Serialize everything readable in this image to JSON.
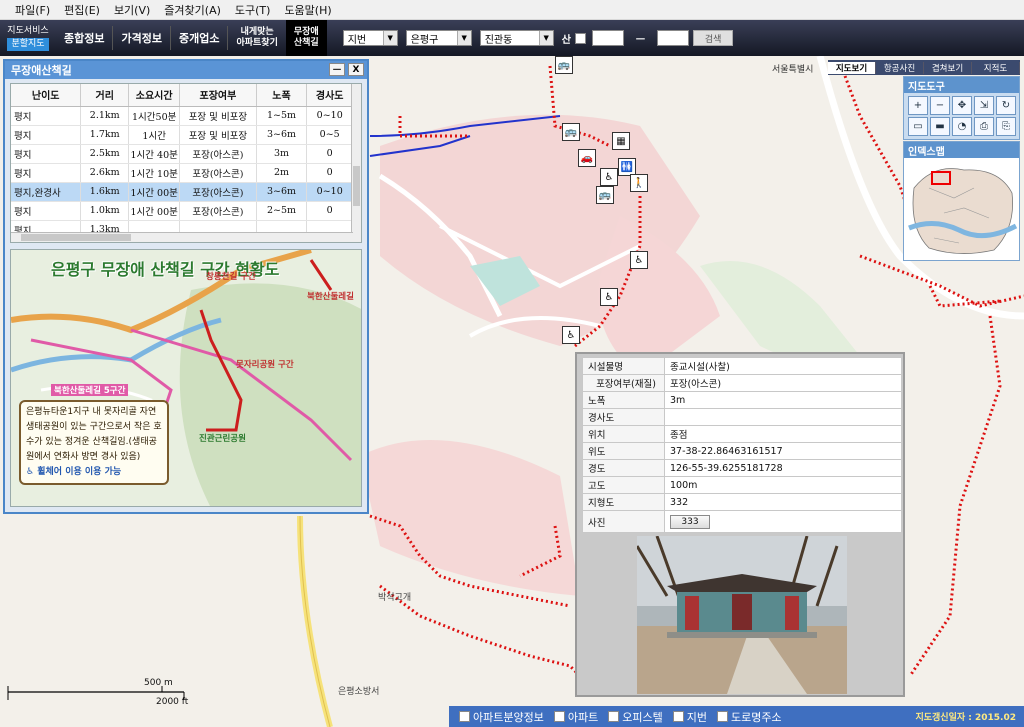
{
  "menu": [
    "파일(F)",
    "편집(E)",
    "보기(V)",
    "즐겨찾기(A)",
    "도구(T)",
    "도움말(H)"
  ],
  "topbar": {
    "service_label": "지도서비스",
    "service_sub": "분할지도",
    "nav": [
      "종합정보",
      "가격정보",
      "중개업소"
    ],
    "nav_small": [
      "내게맞는",
      "아파트찾기"
    ],
    "active": [
      "무장애",
      "산책길"
    ],
    "selects": [
      "지번",
      "은평구",
      "진관동"
    ],
    "mountain_label": "산",
    "dash": "ㅡ",
    "search_label": "검색"
  },
  "panel": {
    "title": "무장애산책길",
    "min": "ㅡ",
    "close": "X",
    "columns": [
      "난이도",
      "거리",
      "소요시간",
      "포장여부",
      "노폭",
      "경사도"
    ],
    "rows": [
      [
        "평지",
        "2.1km",
        "1시간50분",
        "포장 및 비포장",
        "1~5m",
        "0~10"
      ],
      [
        "평지",
        "1.7km",
        "1시간",
        "포장 및 비포장",
        "3~6m",
        "0~5"
      ],
      [
        "평지",
        "2.5km",
        "1시간 40분",
        "포장(아스콘)",
        "3m",
        "0"
      ],
      [
        "평지",
        "2.6km",
        "1시간 10분",
        "포장(아스콘)",
        "2m",
        "0"
      ],
      [
        "평지,완경사",
        "1.6km",
        "1시간 00분",
        "포장(아스콘)",
        "3~6m",
        "0~10"
      ],
      [
        "평지",
        "1.0km",
        "1시간 00분",
        "포장(아스콘)",
        "2~5m",
        "0"
      ],
      [
        "평지",
        "1.3km",
        "",
        "",
        "",
        ""
      ]
    ],
    "highlight_row": 4
  },
  "minimap": {
    "title": "은평구 무장애 산책길 구간 현황도",
    "labels": [
      "창릉천길 구간",
      "북한산둘레길",
      "북한산둘레길 5구간",
      "못자리공원 구간",
      "진관근린공원"
    ],
    "note": "은평뉴타운1지구 내 못자리골 자연생태공원이 있는 구간으로서 작은 호수가 있는 정겨운 산책길임.(생태공원에서 연화사 방면 경사 있음)",
    "wheelchair": "휠체어 이용 이용 가능"
  },
  "popup": {
    "rows": [
      [
        "시설물명",
        "종교시설(사찰)"
      ],
      [
        "포장여부(재질)",
        "포장(아스콘)"
      ],
      [
        "노폭",
        "3m"
      ],
      [
        "경사도",
        ""
      ],
      [
        "위치",
        "종점"
      ],
      [
        "위도",
        "37-38-22.86463161517"
      ],
      [
        "경도",
        "126-55-39.6255181728"
      ],
      [
        "고도",
        "100m"
      ],
      [
        "지형도",
        "332"
      ]
    ],
    "photo_label": "사진",
    "photo_button": "333"
  },
  "right": {
    "seoul": "서울특별시",
    "tabs": [
      "지도보기",
      "항공사진",
      "겹쳐보기",
      "지적도"
    ],
    "tools_title": "지도도구",
    "tool_icons": [
      "+",
      "−",
      "✥",
      "⇲",
      "↻",
      "▭",
      "▬",
      "◔",
      "⎙",
      "⎘"
    ],
    "index_title": "인덱스맵"
  },
  "map_labels": [
    "박석고개",
    "은평소방서"
  ],
  "scale": {
    "m": "500 m",
    "ft": "2000 ft"
  },
  "bottom": {
    "items": [
      "아파트분양정보",
      "아파트",
      "오피스텔",
      "지번",
      "도로명주소"
    ],
    "date": "지도갱신일자 : 2015.02"
  }
}
